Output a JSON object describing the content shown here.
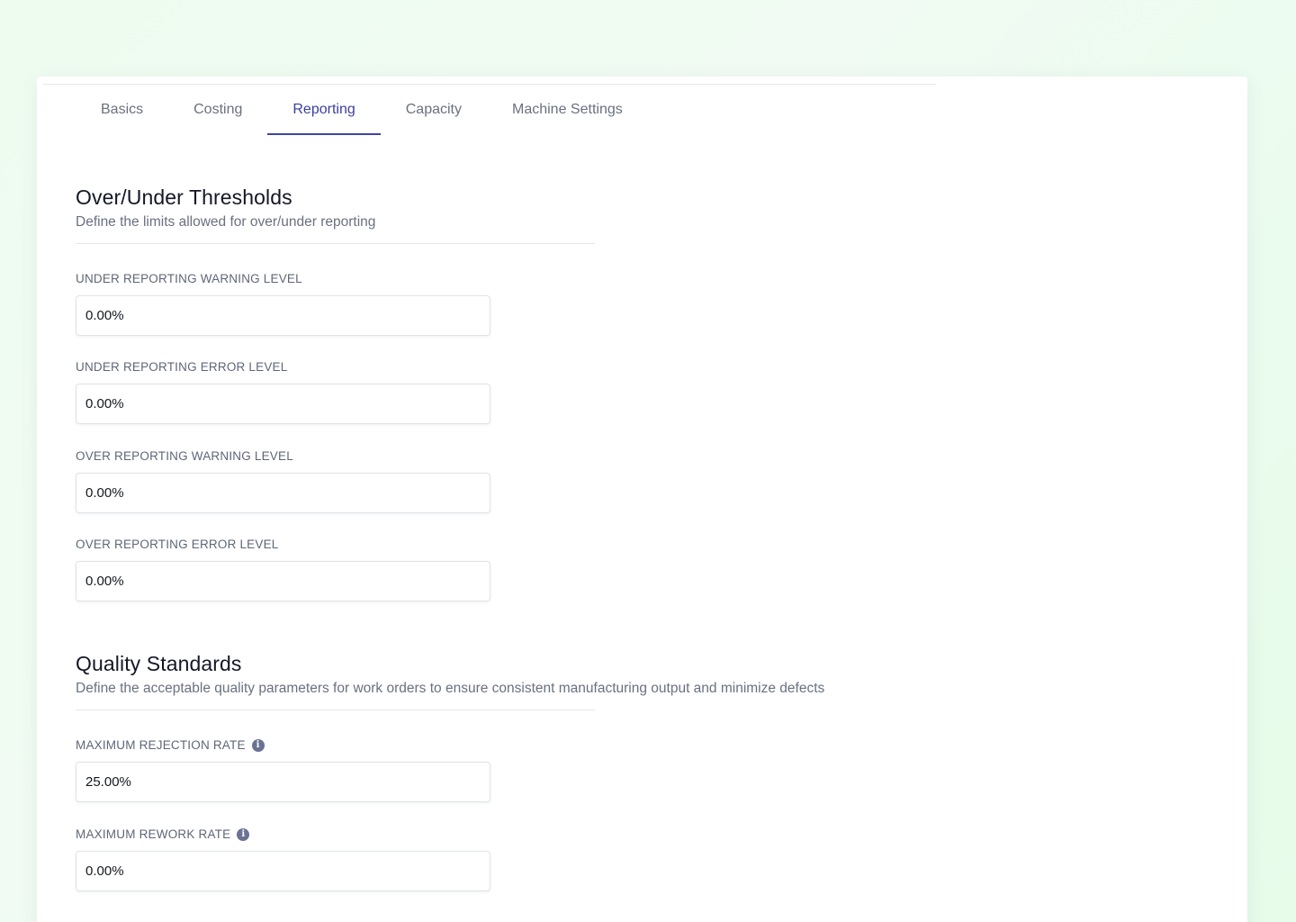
{
  "tabs": [
    {
      "label": "Basics"
    },
    {
      "label": "Costing"
    },
    {
      "label": "Reporting"
    },
    {
      "label": "Capacity"
    },
    {
      "label": "Machine Settings"
    }
  ],
  "active_tab": "Reporting",
  "accent_color": "#3e43a8",
  "thresholds": {
    "title": "Over/Under Thresholds",
    "description": "Define the limits allowed for over/under reporting",
    "fields": [
      {
        "label": "UNDER REPORTING WARNING LEVEL",
        "value": "0.00%"
      },
      {
        "label": "UNDER REPORTING ERROR LEVEL",
        "value": "0.00%"
      },
      {
        "label": "OVER REPORTING WARNING LEVEL",
        "value": "0.00%"
      },
      {
        "label": "OVER REPORTING ERROR LEVEL",
        "value": "0.00%"
      }
    ]
  },
  "quality": {
    "title": "Quality Standards",
    "description": "Define the acceptable quality parameters for work orders to ensure consistent manufacturing output and minimize defects",
    "fields": [
      {
        "label": "MAXIMUM REJECTION RATE",
        "value": "25.00%",
        "icon": "info-icon"
      },
      {
        "label": "MAXIMUM REWORK RATE",
        "value": "0.00%",
        "icon": "info-icon"
      }
    ]
  }
}
